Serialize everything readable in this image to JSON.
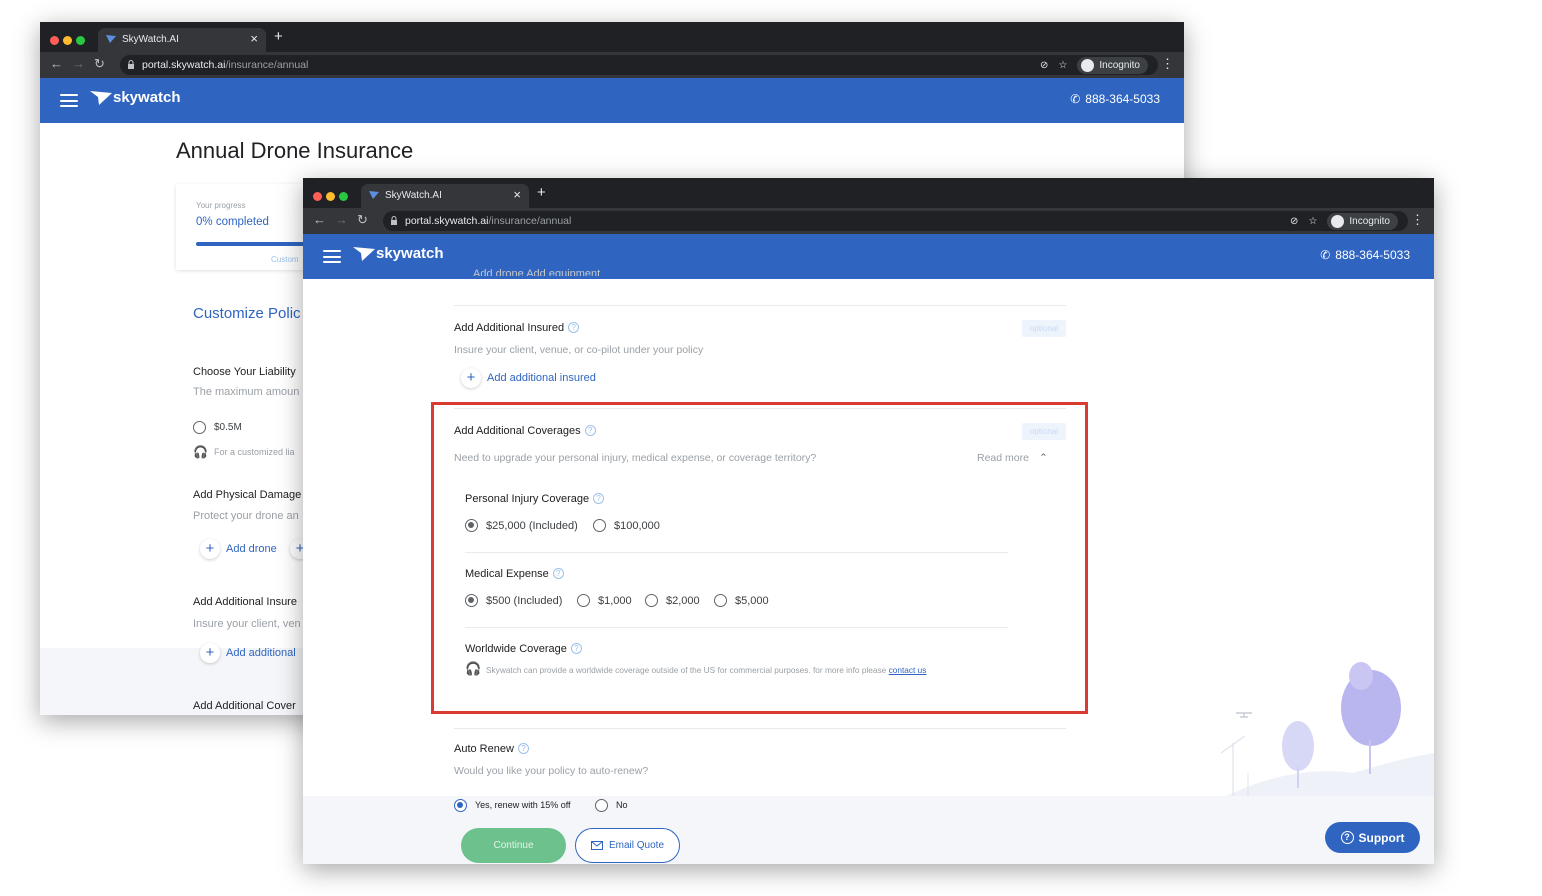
{
  "browser": {
    "tab_title": "SkyWatch.AI",
    "new_tab": "+",
    "url_host": "portal.skywatch.ai",
    "url_path": "/insurance/annual",
    "incognito_label": "Incognito"
  },
  "site": {
    "logo_text": "skywatch",
    "phone": "888-364-5033",
    "brand_color": "#2f65c1"
  },
  "back_page": {
    "title": "Annual Drone Insurance",
    "progress_label": "Your progress",
    "progress_value": "0% completed",
    "progress_step": "Custom",
    "section_title": "Customize Polic",
    "liability_title": "Choose Your Liability",
    "liability_desc": "The maximum amoun",
    "liability_option": "$0.5M",
    "liability_note": "For a customized lia",
    "physical_title": "Add Physical Damage",
    "physical_desc": "Protect your drone an",
    "add_drone": "Add drone",
    "additional_insured_title": "Add Additional Insure",
    "additional_insured_desc": "Insure your client, ven",
    "add_additional": "Add additional",
    "additional_cover_title": "Add Additional Cover"
  },
  "front_page": {
    "top_partial": "Add drone      Add equipment",
    "additional_insured": {
      "title": "Add Additional Insured",
      "badge": "optional",
      "desc": "Insure your client, venue, or co-pilot under your policy",
      "add_label": "Add additional insured"
    },
    "additional_coverages": {
      "title": "Add Additional Coverages",
      "badge": "optional",
      "desc": "Need to upgrade your personal injury, medical expense, or coverage territory?",
      "read_more": "Read more",
      "personal_injury": {
        "title": "Personal Injury Coverage",
        "options": [
          "$25,000 (Included)",
          "$100,000"
        ],
        "selected": 0
      },
      "medical_expense": {
        "title": "Medical Expense",
        "options": [
          "$500 (Included)",
          "$1,000",
          "$2,000",
          "$5,000"
        ],
        "selected": 0
      },
      "worldwide": {
        "title": "Worldwide Coverage",
        "text": "Skywatch can provide a worldwide coverage outside of the US for commercial purposes. for more info please",
        "link": "contact us"
      }
    },
    "auto_renew": {
      "title": "Auto Renew",
      "question": "Would you like your policy to auto-renew?",
      "options": [
        "Yes, renew with 15% off",
        "No"
      ],
      "selected": 0
    },
    "continue_label": "Continue",
    "email_quote_label": "Email Quote",
    "support_label": "Support"
  }
}
